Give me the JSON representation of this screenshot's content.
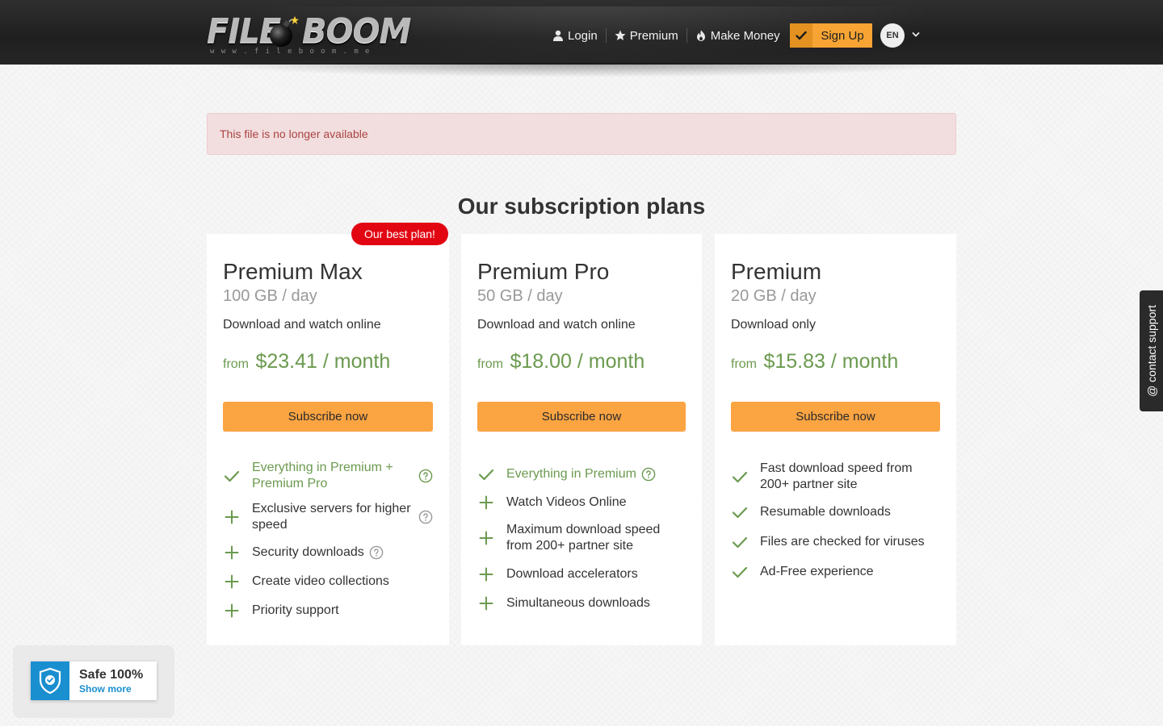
{
  "header": {
    "logo": {
      "word1": "FILE",
      "word2": "BOOM",
      "url": "www.fileboom.me"
    },
    "nav": {
      "login": "Login",
      "premium": "Premium",
      "make_money": "Make Money",
      "signup": "Sign Up",
      "language": "EN"
    }
  },
  "alert": {
    "text": "This file is no longer available"
  },
  "plans": {
    "title": "Our subscription plans",
    "best_badge": "Our best plan!",
    "price_prefix": "from",
    "subscribe_label": "Subscribe now",
    "items": [
      {
        "name": "Premium Max",
        "quota": "100 GB / day",
        "description": "Download and watch online",
        "price": "$23.41 / month",
        "features": [
          {
            "text": "Everything in Premium + Premium Pro",
            "icon": "check-icon",
            "highlight": true,
            "help": true
          },
          {
            "text": "Exclusive servers for higher speed",
            "icon": "plus-icon",
            "highlight": false,
            "help": true
          },
          {
            "text": "Security downloads",
            "icon": "plus-icon",
            "highlight": false,
            "help": true
          },
          {
            "text": "Create video collections",
            "icon": "plus-icon",
            "highlight": false,
            "help": false
          },
          {
            "text": "Priority support",
            "icon": "plus-icon",
            "highlight": false,
            "help": false
          }
        ]
      },
      {
        "name": "Premium Pro",
        "quota": "50 GB / day",
        "description": "Download and watch online",
        "price": "$18.00 / month",
        "features": [
          {
            "text": "Everything in Premium",
            "icon": "check-icon",
            "highlight": true,
            "help": true
          },
          {
            "text": "Watch Videos Online",
            "icon": "plus-icon",
            "highlight": false,
            "help": false
          },
          {
            "text": "Maximum download speed from 200+ partner site",
            "icon": "plus-icon",
            "highlight": false,
            "help": false
          },
          {
            "text": "Download accelerators",
            "icon": "plus-icon",
            "highlight": false,
            "help": false
          },
          {
            "text": "Simultaneous downloads",
            "icon": "plus-icon",
            "highlight": false,
            "help": false
          }
        ]
      },
      {
        "name": "Premium",
        "quota": "20 GB / day",
        "description": "Download only",
        "price": "$15.83 / month",
        "features": [
          {
            "text": "Fast download speed from 200+ partner site",
            "icon": "check-icon",
            "highlight": false,
            "help": false
          },
          {
            "text": "Resumable downloads",
            "icon": "check-icon",
            "highlight": false,
            "help": false
          },
          {
            "text": "Files are checked for viruses",
            "icon": "check-icon",
            "highlight": false,
            "help": false
          },
          {
            "text": "Ad-Free experience",
            "icon": "check-icon",
            "highlight": false,
            "help": false
          }
        ]
      }
    ]
  },
  "support_tab": {
    "text": "@ contact support"
  },
  "safe_widget": {
    "title": "Safe 100%",
    "link": "Show more"
  },
  "colors": {
    "accent_orange": "#fba442",
    "price_green": "#6b9a4f",
    "badge_red": "#e20613",
    "alert_bg": "#f2dede",
    "alert_text": "#a94442",
    "shield_blue": "#1a8fd0"
  }
}
